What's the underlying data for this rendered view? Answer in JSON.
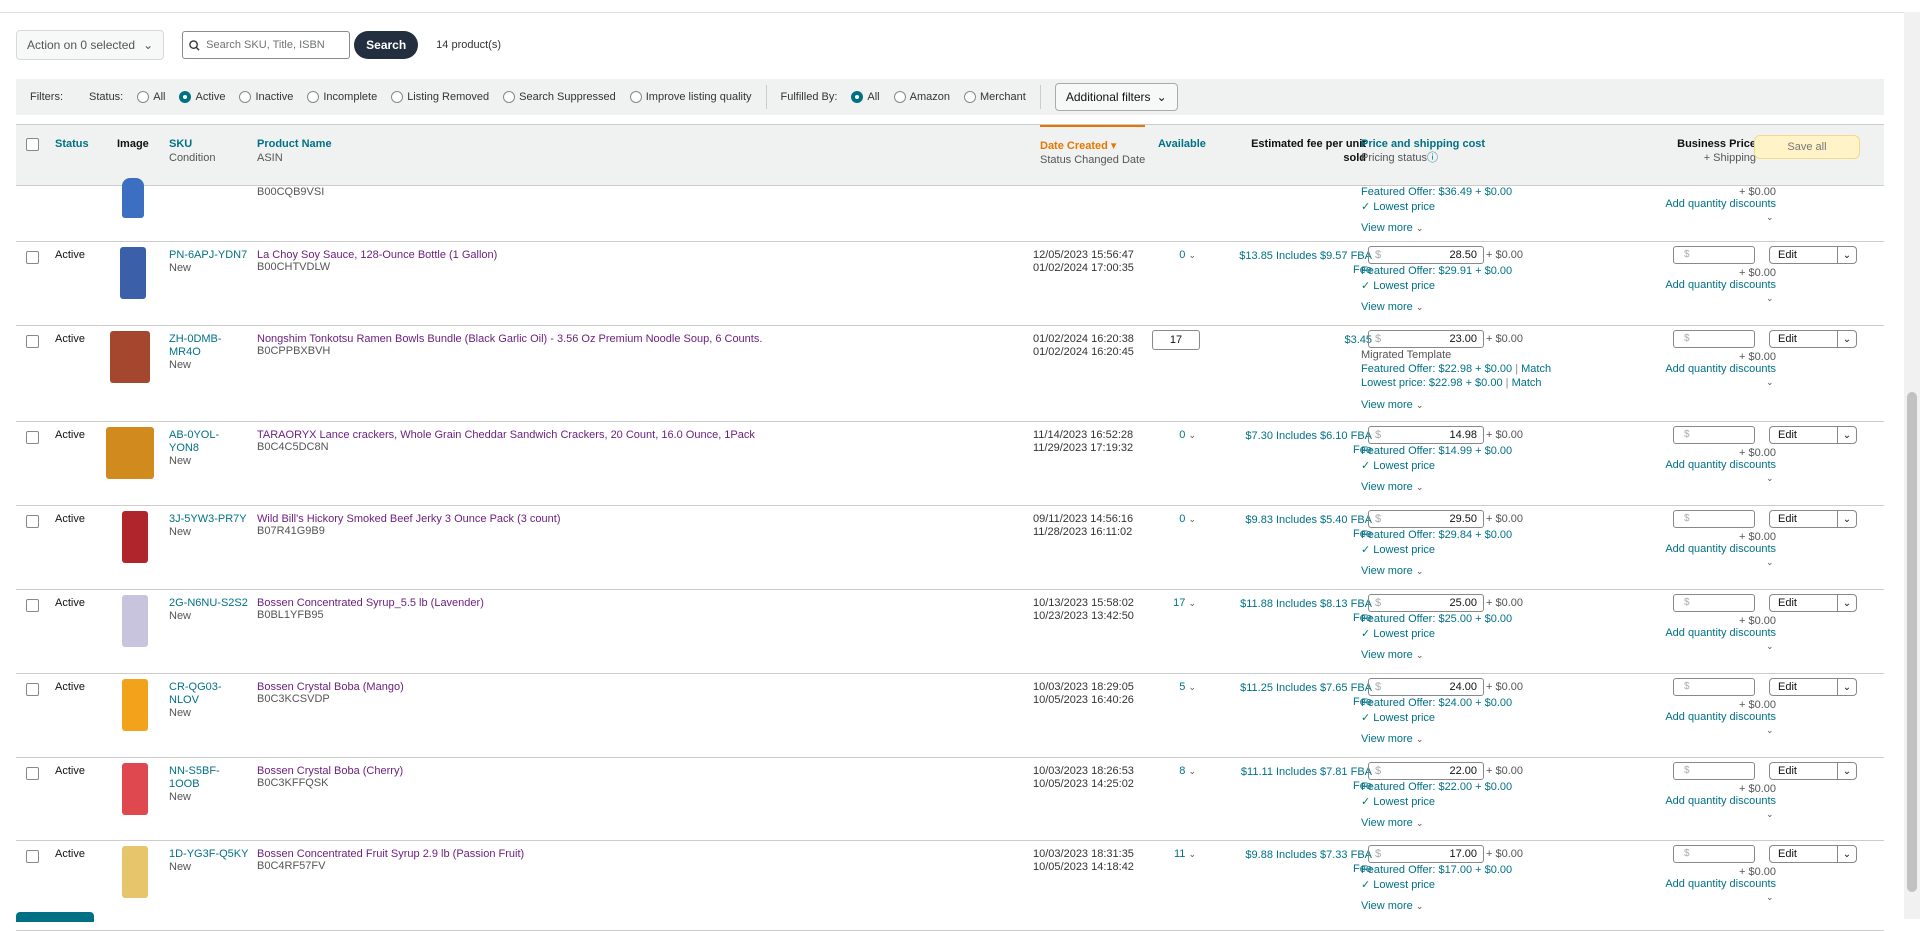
{
  "toolbar": {
    "action_label": "Action on 0 selected",
    "search_placeholder": "Search SKU, Title, ISBN",
    "search_button": "Search",
    "product_count": "14 product(s)"
  },
  "filters": {
    "label": "Filters:",
    "status_label": "Status:",
    "status_options": [
      "All",
      "Active",
      "Inactive",
      "Incomplete",
      "Listing Removed",
      "Search Suppressed",
      "Improve listing quality"
    ],
    "status_selected": "Active",
    "fulfilled_label": "Fulfilled By:",
    "fulfilled_options": [
      "All",
      "Amazon",
      "Merchant"
    ],
    "fulfilled_selected": "All",
    "additional": "Additional filters"
  },
  "headers": {
    "status": "Status",
    "image": "Image",
    "sku": "SKU",
    "condition": "Condition",
    "product_name": "Product Name",
    "asin": "ASIN",
    "date_created": "Date Created",
    "status_changed": "Status Changed Date",
    "available": "Available",
    "fee_1": "Estimated fee per unit",
    "fee_2": "sold",
    "price": "Price and shipping cost",
    "pricing_status": "Pricing status",
    "business_price": "Business Price",
    "plus_shipping": "+ Shipping",
    "save_all": "Save all"
  },
  "partial_row": {
    "asin": "B00CQB9VSI",
    "featured": "Featured Offer: $36.49 + $0.00",
    "lowest": "Lowest price",
    "view_more": "View more",
    "biz_ship": "+ $0.00",
    "qty_discount": "Add quantity discounts"
  },
  "rows": [
    {
      "status": "Active",
      "sku": "PN-6APJ-YDN7",
      "condition": "New",
      "name": "La Choy Soy Sauce, 128-Ounce Bottle (1 Gallon)",
      "asin": "B00CHTVDLW",
      "created": "12/05/2023 15:56:47",
      "changed": "01/02/2024 17:00:35",
      "available": "0",
      "fee": "$13.85 Includes $9.57 FBA",
      "fee2": "Fee",
      "price": "28.50",
      "ship": "+ $0.00",
      "featured": "Featured Offer: $29.91 + $0.00",
      "lowest": "Lowest price",
      "view_more": "View more",
      "biz_ship": "+ $0.00",
      "qty": "Add quantity discounts",
      "edit": "Edit",
      "img_color": "#3b5fa8"
    },
    {
      "status": "Active",
      "sku": "ZH-0DMB-MR4O",
      "condition": "New",
      "name": "Nongshim Tonkotsu Ramen Bowls Bundle (Black Garlic Oil) - 3.56 Oz Premium Noodle Soup, 6 Counts.",
      "asin": "B0CPPBXBVH",
      "created": "01/02/2024 16:20:38",
      "changed": "01/02/2024 16:20:45",
      "available": "17",
      "fee": "$3.45",
      "fee2": "",
      "price": "23.00",
      "ship": "+ $0.00",
      "template": "Migrated Template",
      "featured": "Featured Offer: $22.98 + $0.00",
      "match": "Match",
      "lowest_price": "Lowest price: $22.98 + $0.00",
      "view_more": "View more",
      "biz_ship": "+ $0.00",
      "qty": "Add quantity discounts",
      "edit": "Edit",
      "img_color": "#a4472e"
    },
    {
      "status": "Active",
      "sku": "AB-0YOL-YON8",
      "condition": "New",
      "name": "TARAORYX Lance crackers, Whole Grain Cheddar Sandwich Crackers, 20 Count, 16.0 Ounce, 1Pack",
      "asin": "B0C4C5DC8N",
      "created": "11/14/2023 16:52:28",
      "changed": "11/29/2023 17:19:32",
      "available": "0",
      "fee": "$7.30 Includes $6.10 FBA",
      "fee2": "Fee",
      "price": "14.98",
      "ship": "+ $0.00",
      "featured": "Featured Offer: $14.99 + $0.00",
      "lowest": "Lowest price",
      "view_more": "View more",
      "biz_ship": "+ $0.00",
      "qty": "Add quantity discounts",
      "edit": "Edit",
      "img_color": "#d08a1e"
    },
    {
      "status": "Active",
      "sku": "3J-5YW3-PR7Y",
      "condition": "New",
      "name": "Wild Bill's Hickory Smoked Beef Jerky 3 Ounce Pack (3 count)",
      "asin": "B07R41G9B9",
      "created": "09/11/2023 14:56:16",
      "changed": "11/28/2023 16:11:02",
      "available": "0",
      "fee": "$9.83 Includes $5.40 FBA",
      "fee2": "Fee",
      "price": "29.50",
      "ship": "+ $0.00",
      "featured": "Featured Offer: $29.84 + $0.00",
      "lowest": "Lowest price",
      "view_more": "View more",
      "biz_ship": "+ $0.00",
      "qty": "Add quantity discounts",
      "edit": "Edit",
      "img_color": "#b0252b"
    },
    {
      "status": "Active",
      "sku": "2G-N6NU-S2S2",
      "condition": "New",
      "name": "Bossen Concentrated Syrup_5.5 lb (Lavender)",
      "asin": "B0BL1YFB95",
      "created": "10/13/2023 15:58:02",
      "changed": "10/23/2023 13:42:50",
      "available": "17",
      "fee": "$11.88 Includes $8.13 FBA",
      "fee2": "Fee",
      "price": "25.00",
      "ship": "+ $0.00",
      "featured": "Featured Offer: $25.00 + $0.00",
      "lowest": "Lowest price",
      "view_more": "View more",
      "biz_ship": "+ $0.00",
      "qty": "Add quantity discounts",
      "edit": "Edit",
      "img_color": "#c9c4dd"
    },
    {
      "status": "Active",
      "sku": "CR-QG03-NLOV",
      "condition": "New",
      "name": "Bossen Crystal Boba (Mango)",
      "asin": "B0C3KCSVDP",
      "created": "10/03/2023 18:29:05",
      "changed": "10/05/2023 16:40:26",
      "available": "5",
      "fee": "$11.25 Includes $7.65 FBA",
      "fee2": "Fee",
      "price": "24.00",
      "ship": "+ $0.00",
      "featured": "Featured Offer: $24.00 + $0.00",
      "lowest": "Lowest price",
      "view_more": "View more",
      "biz_ship": "+ $0.00",
      "qty": "Add quantity discounts",
      "edit": "Edit",
      "img_color": "#f2a21b"
    },
    {
      "status": "Active",
      "sku": "NN-S5BF-1OOB",
      "condition": "New",
      "name": "Bossen Crystal Boba (Cherry)",
      "asin": "B0C3KFFQSK",
      "created": "10/03/2023 18:26:53",
      "changed": "10/05/2023 14:25:02",
      "available": "8",
      "fee": "$11.11 Includes $7.81 FBA",
      "fee2": "Fee",
      "price": "22.00",
      "ship": "+ $0.00",
      "featured": "Featured Offer: $22.00 + $0.00",
      "lowest": "Lowest price",
      "view_more": "View more",
      "biz_ship": "+ $0.00",
      "qty": "Add quantity discounts",
      "edit": "Edit",
      "img_color": "#e0484f"
    },
    {
      "status": "Active",
      "sku": "1D-YG3F-Q5KY",
      "condition": "New",
      "name": "Bossen Concentrated Fruit Syrup 2.9 lb (Passion Fruit)",
      "asin": "B0C4RF57FV",
      "created": "10/03/2023 18:31:35",
      "changed": "10/05/2023 14:18:42",
      "available": "11",
      "fee": "$9.88 Includes $7.33 FBA",
      "fee2": "Fee",
      "price": "17.00",
      "ship": "+ $0.00",
      "featured": "Featured Offer: $17.00 + $0.00",
      "lowest": "Lowest price",
      "view_more": "View more",
      "biz_ship": "+ $0.00",
      "qty": "Add quantity discounts",
      "edit": "Edit",
      "img_color": "#e7c66b"
    }
  ]
}
